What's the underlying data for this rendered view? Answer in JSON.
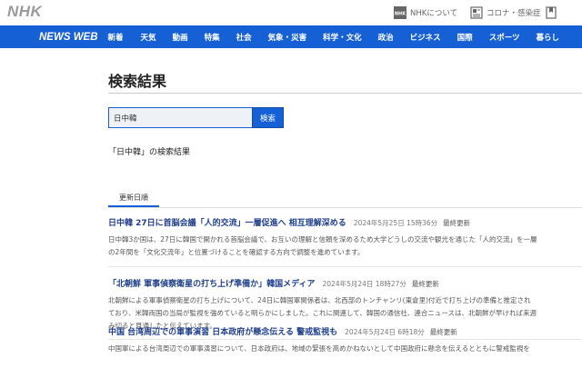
{
  "header": {
    "logo": "NHK",
    "links": [
      {
        "label": "NHKについて",
        "icon": "nhk-logo-icon"
      },
      {
        "label": "コロナ・感染症",
        "icon": "newspaper-icon"
      },
      {
        "label": "",
        "icon": "bookmark-icon"
      }
    ]
  },
  "nav": {
    "brand": "NEWS WEB",
    "items": [
      "新着",
      "天気",
      "動画",
      "特集",
      "社会",
      "気象・災害",
      "科学・文化",
      "政治",
      "ビジネス",
      "国際",
      "スポーツ",
      "暮らし"
    ]
  },
  "main": {
    "title": "検索結果",
    "search": {
      "value": "日中韓",
      "button": "検索"
    },
    "caption": "「日中韓」の検索結果",
    "sort_label": "更新日順"
  },
  "results": [
    {
      "title": "日中韓 27日に首脳会議「人的交流」一層促進へ 相互理解深める",
      "date": "2024年5月25日 15時36分",
      "tag": "最終更新",
      "lines": [
        "日中韓3か国は、27日に韓国で開かれる首脳会議で、お互いの理解と信頼を深めるため大学どうしの交流や観光を通じた「人的交流」を一層",
        "の2年間を「文化交流年」と位置づけることを確認する方向で調整を進めています。"
      ]
    },
    {
      "title": "「北朝鮮 軍事偵察衛星の打ち上げ準備か」韓国メディア",
      "date": "2024年5月24日 18時27分",
      "tag": "最終更新",
      "lines": [
        "北朝鮮による軍事偵察衛星の打ち上げについて、24日に韓国軍関係者は、北西部のトンチャンリ(東倉里)付近で打ち上げの準備と推定され",
        "ており、米韓両国の当局が監視を強めていると明らかにしました。これに関連して、韓国の通信社、連合ニュースは、北朝鮮が早ければ来週",
        "み切ると見通したと伝えています。"
      ]
    },
    {
      "title": "中国 台湾周辺での軍事演習 日本政府が懸念伝える 警戒監視も",
      "date": "2024年5月24日 6時18分",
      "tag": "最終更新",
      "lines": [
        "中国軍による台湾周辺での軍事演習について、日本政府は、地域の緊張を高めかねないとして中国政府に懸念を伝えるとともに警戒監視を"
      ]
    }
  ],
  "colors": {
    "accent": "#1560d4",
    "title_link": "#1f3f8a"
  }
}
